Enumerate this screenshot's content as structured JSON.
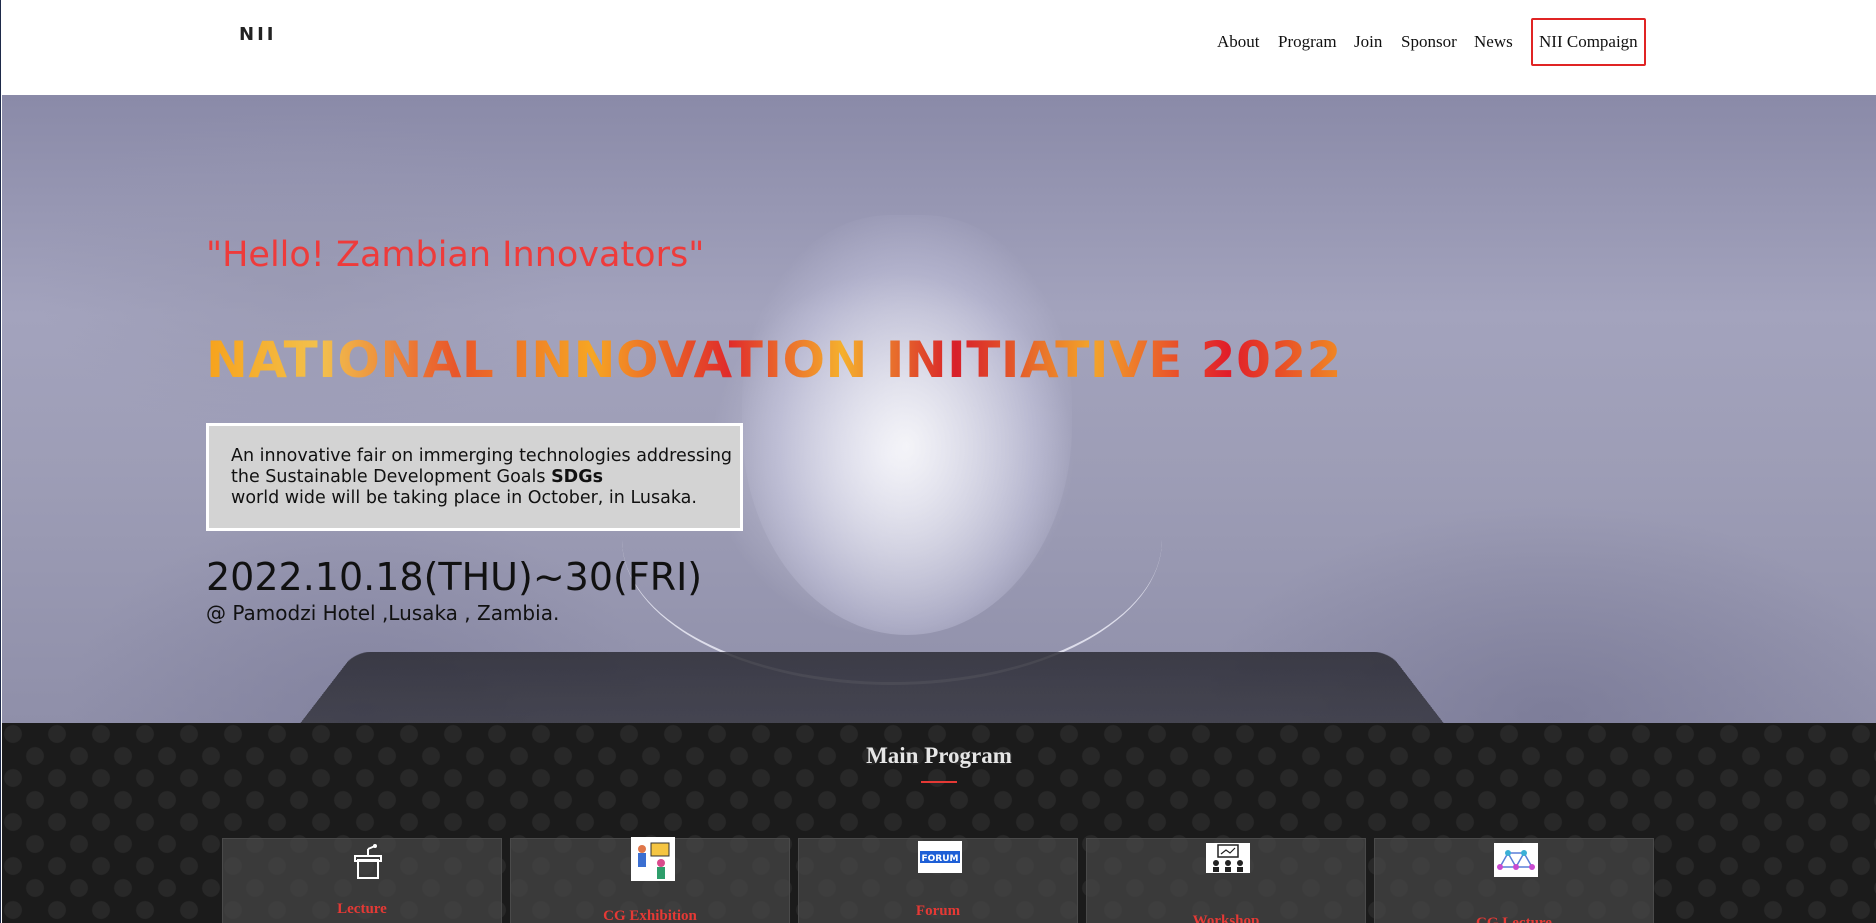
{
  "header": {
    "logo": "NII",
    "nav": [
      {
        "label": "About"
      },
      {
        "label": "Program"
      },
      {
        "label": "Join"
      },
      {
        "label": "Sponsor"
      },
      {
        "label": "News"
      },
      {
        "label": "NII Compaign"
      }
    ]
  },
  "hero": {
    "tagline": "\"Hello! Zambian Innovators\"",
    "headline": "NATIONAL INNOVATION INITIATIVE 2022",
    "description": {
      "line1": "An innovative fair on immerging technologies addressing",
      "line2_prefix": "the Sustainable Development Goals ",
      "line2_bold": "SDGs",
      "line3": "world wide will be taking place in October, in Lusaka."
    },
    "date": "2022.10.18(THU)~30(FRI)",
    "venue": "@ Pamodzi Hotel ,Lusaka , Zambia."
  },
  "program": {
    "title": "Main Program",
    "cards": [
      {
        "label": "Lecture",
        "icon": "podium-icon"
      },
      {
        "label": "CG Exhibition",
        "icon": "exhibition-icon"
      },
      {
        "label": "Forum",
        "icon": "forum-icon"
      },
      {
        "label": "Workshop",
        "icon": "workshop-icon"
      },
      {
        "label": "CG Lecture",
        "icon": "network-icon"
      }
    ]
  },
  "colors": {
    "accent_red": "#e53935",
    "nav_highlight_border": "#e02424",
    "program_bg": "#1b1b1b"
  }
}
